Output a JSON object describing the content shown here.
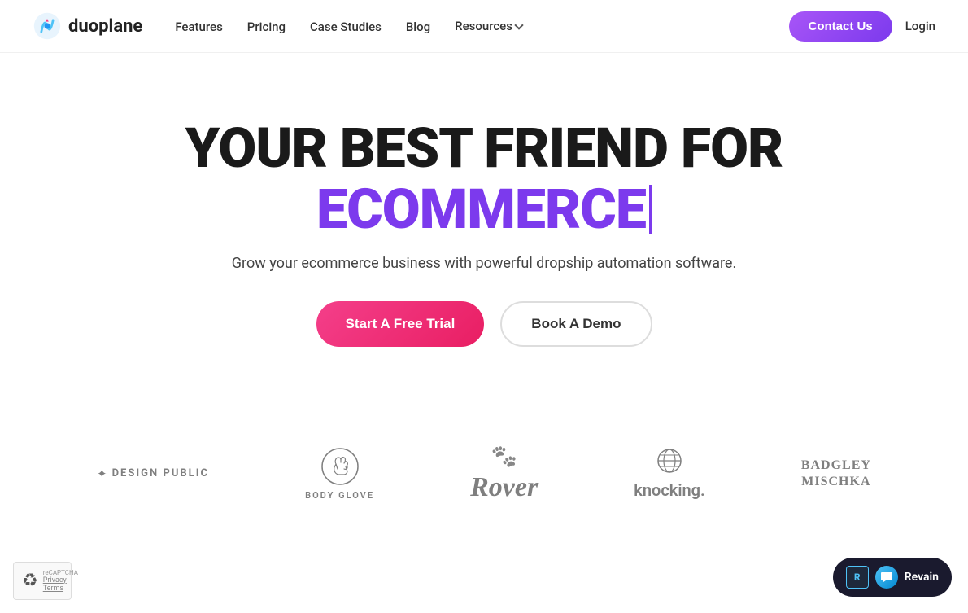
{
  "navbar": {
    "logo_text": "duoplane",
    "nav_items": [
      {
        "label": "Features",
        "has_dropdown": false
      },
      {
        "label": "Pricing",
        "has_dropdown": false
      },
      {
        "label": "Case Studies",
        "has_dropdown": false
      },
      {
        "label": "Blog",
        "has_dropdown": false
      },
      {
        "label": "Resources",
        "has_dropdown": true
      }
    ],
    "contact_btn": "Contact Us",
    "login_link": "Login"
  },
  "hero": {
    "title_line1": "YOUR BEST FRIEND FOR",
    "title_line2": "ECOMMERCE",
    "subtitle": "Grow your ecommerce business with powerful dropship automation software.",
    "btn_primary": "Start A Free Trial",
    "btn_secondary": "Book A Demo"
  },
  "logos": [
    {
      "id": "design-public",
      "label": "DESIGN PUBLIC"
    },
    {
      "id": "body-glove",
      "label": "BODY GLOVE"
    },
    {
      "id": "rover",
      "label": "Rover"
    },
    {
      "id": "knocking",
      "label": "knocking."
    },
    {
      "id": "badgley-mischka",
      "label": "BADGLEY\nMISCHKA"
    }
  ],
  "chat_widget": {
    "label": "Revain"
  },
  "recaptcha": {
    "privacy": "Privacy",
    "terms": "Terms"
  }
}
